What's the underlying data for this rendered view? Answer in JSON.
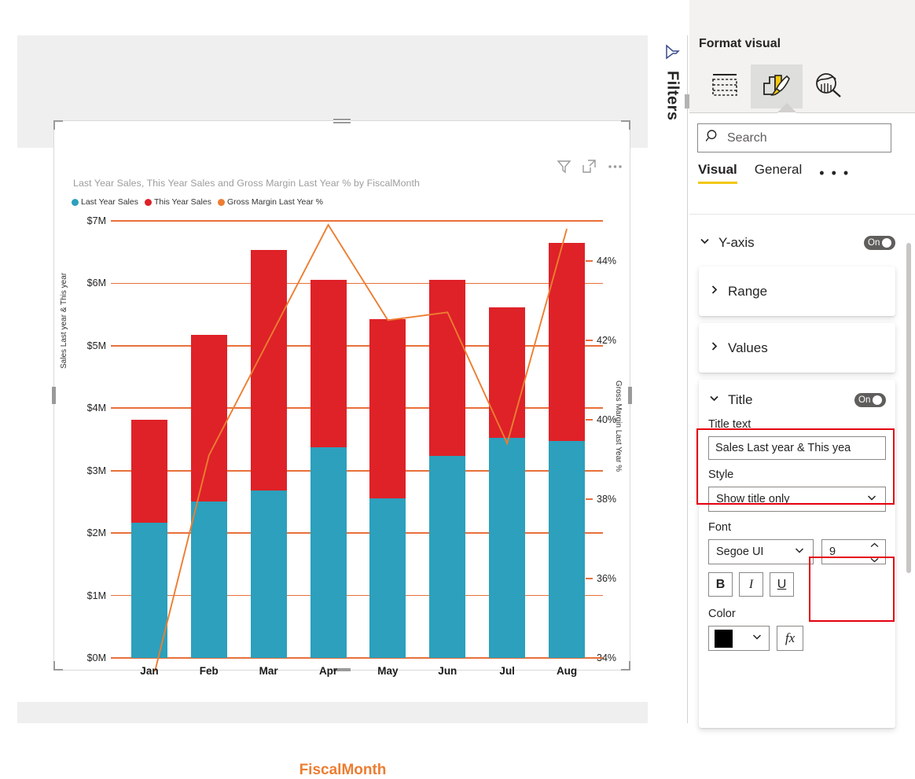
{
  "report": {
    "visual_header": {
      "filter_icon": "filter-icon",
      "focus_icon": "focus-mode-icon",
      "more_icon": "more-options-icon"
    },
    "chart_title": "Last Year Sales, This Year Sales and Gross Margin Last Year % by FiscalMonth"
  },
  "filters_pane": {
    "label": "Filters",
    "icon": "filter-funnel-icon"
  },
  "format_pane": {
    "title": "Format visual",
    "tabs": [
      {
        "name": "fields-tab",
        "icon": "fields-table-icon",
        "active": false
      },
      {
        "name": "format-tab",
        "icon": "paintbrush-chart-icon",
        "active": true
      },
      {
        "name": "analytics-tab",
        "icon": "magnifier-chart-icon",
        "active": false
      }
    ],
    "search": {
      "placeholder": "Search",
      "icon": "search-icon",
      "value": ""
    },
    "section_tabs": [
      {
        "label": "Visual",
        "active": true
      },
      {
        "label": "General",
        "active": false
      }
    ],
    "section_more": "• • •",
    "yaxis": {
      "label": "Y-axis",
      "toggle_text": "On",
      "toggle_on": true,
      "cards": [
        {
          "label": "Range",
          "expanded": false
        },
        {
          "label": "Values",
          "expanded": false
        }
      ],
      "title_card": {
        "label": "Title",
        "toggle_text": "On",
        "toggle_on": true,
        "title_text_label": "Title text",
        "title_text_value": "Sales Last year & This yea",
        "style_label": "Style",
        "style_value": "Show title only",
        "font_label": "Font",
        "font_family": "Segoe UI",
        "font_size": "9",
        "bold_label": "B",
        "italic_label": "I",
        "underline_label": "U",
        "color_label": "Color",
        "color_value": "#000000",
        "fx_label": "fx"
      }
    }
  },
  "chart_data": {
    "type": "bar",
    "title": "Last Year Sales, This Year Sales and Gross Margin Last Year % by FiscalMonth",
    "xlabel": "FiscalMonth",
    "ylabel": "Sales Last year & This year",
    "y2label": "Gross Margin Last Year %",
    "categories": [
      "Jan",
      "Feb",
      "Mar",
      "Apr",
      "May",
      "Jun",
      "Jul",
      "Aug"
    ],
    "ylim": [
      0,
      7
    ],
    "y2lim": [
      34,
      45
    ],
    "y_ticks": [
      "$0M",
      "$1M",
      "$2M",
      "$3M",
      "$4M",
      "$5M",
      "$6M",
      "$7M"
    ],
    "y_tick_values": [
      0,
      1,
      2,
      3,
      4,
      5,
      6,
      7
    ],
    "y2_ticks": [
      "34%",
      "36%",
      "38%",
      "40%",
      "42%",
      "44%"
    ],
    "y2_tick_values": [
      34,
      36,
      38,
      40,
      42,
      44
    ],
    "grid": true,
    "legend_position": "top-left",
    "colors": {
      "last_year_sales": "#2CA0BC",
      "this_year_sales": "#DE2228",
      "gross_margin": "#ED7D31",
      "gridline": "#E8703A",
      "xaxis_title": "#ED7D31"
    },
    "series": [
      {
        "name": "Last Year Sales",
        "type": "bar-stacked",
        "color": "#2CA0BC",
        "unit": "$M",
        "values": [
          2.17,
          2.51,
          2.68,
          3.38,
          2.55,
          3.24,
          3.52,
          3.47
        ]
      },
      {
        "name": "This Year Sales",
        "type": "bar-stacked",
        "color": "#DE2228",
        "unit": "$M",
        "values": [
          1.64,
          2.66,
          3.86,
          2.67,
          2.88,
          2.82,
          2.09,
          3.18
        ]
      },
      {
        "name": "Gross Margin Last Year %",
        "type": "line",
        "color": "#ED7D31",
        "axis": "secondary",
        "unit": "%",
        "values": [
          33.1,
          39.1,
          42.0,
          44.9,
          42.5,
          42.7,
          39.4,
          44.8
        ]
      }
    ],
    "stacked_totals": [
      3.81,
      5.17,
      6.54,
      6.05,
      5.43,
      6.06,
      5.61,
      6.65
    ]
  }
}
